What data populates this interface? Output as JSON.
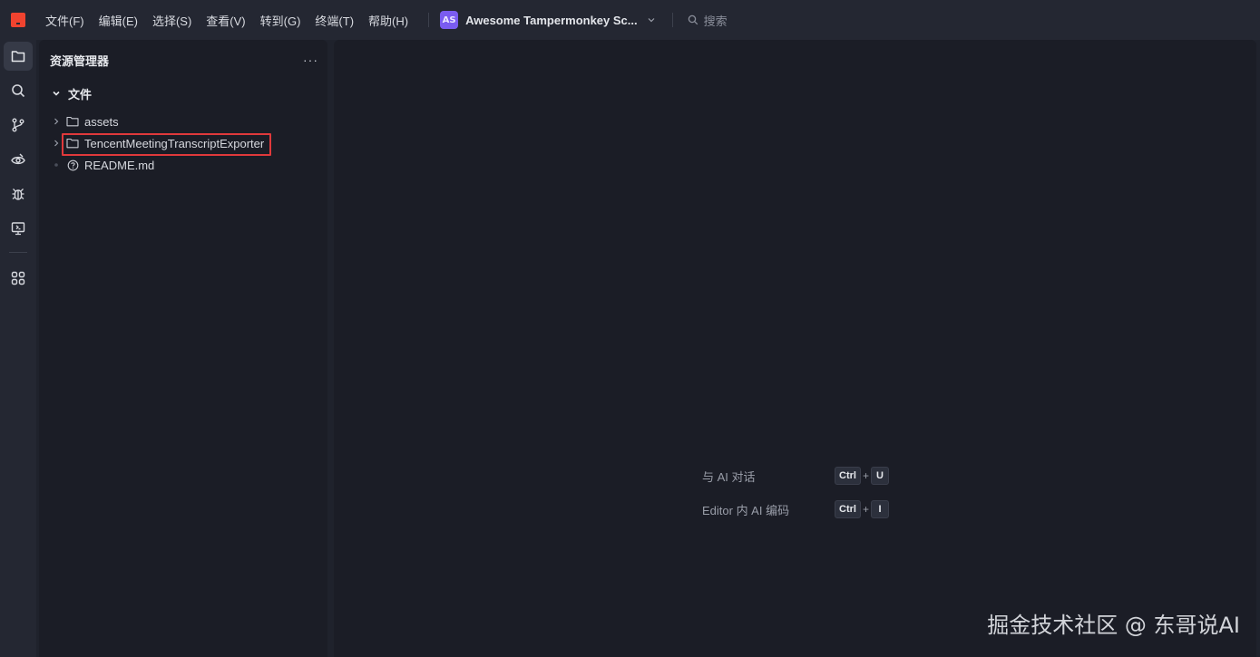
{
  "menu": {
    "items": [
      "文件(F)",
      "编辑(E)",
      "选择(S)",
      "查看(V)",
      "转到(G)",
      "终端(T)",
      "帮助(H)"
    ]
  },
  "project": {
    "avatar": "AS",
    "name": "Awesome Tampermonkey Sc...",
    "avatar_color": "#7a5cf0"
  },
  "search": {
    "placeholder": "搜索"
  },
  "activitybar": {
    "icons": [
      "files-icon",
      "search-icon",
      "source-control-icon",
      "preview-eye-icon",
      "debug-bug-icon",
      "remote-monitor-icon",
      "extensions-grid-icon"
    ],
    "active": "files-icon"
  },
  "explorer": {
    "title": "资源管理器",
    "more": "···",
    "section_title": "文件",
    "tree": [
      {
        "label": "assets",
        "type": "folder"
      },
      {
        "label": "TencentMeetingTranscriptExporter",
        "type": "folder",
        "highlighted": true
      },
      {
        "label": "README.md",
        "type": "file"
      }
    ]
  },
  "editor": {
    "shortcuts": [
      {
        "label": "与 AI 对话",
        "keys": [
          "Ctrl",
          "U"
        ]
      },
      {
        "label": "Editor 内 AI 编码",
        "keys": [
          "Ctrl",
          "I"
        ]
      }
    ],
    "plus": "+"
  },
  "watermark": "掘金技术社区 @ 东哥说AI",
  "colors": {
    "app_logo": "#f0432f",
    "highlight": "#e0393b",
    "background": "#1b1d26",
    "chrome": "#242732"
  }
}
